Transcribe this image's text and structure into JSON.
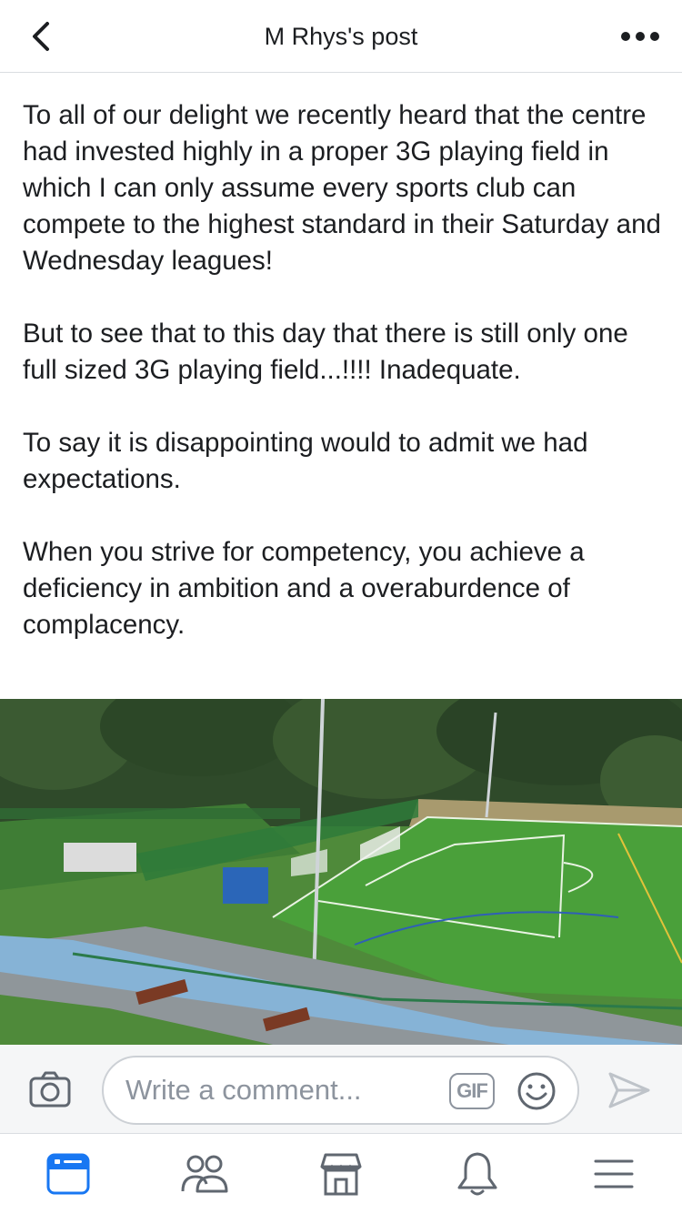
{
  "header": {
    "title": "M Rhys's post",
    "back_icon": "chevron-left-icon",
    "more_icon": "more-horizontal-icon"
  },
  "post": {
    "paragraphs": [
      "To all of our delight we recently heard that the centre had invested highly in a proper 3G playing field in which I can only assume every sports club can compete to the highest standard in their Saturday and Wednesday leagues!",
      "But to see that to this day that there is still only one full sized 3G playing field...!!!! Inadequate.",
      "To say it is disappointing would to admit we had expectations.",
      "When you strive for competency, you achieve a deficiency in ambition and a overaburdence of complacency."
    ]
  },
  "comment_bar": {
    "placeholder": "Write a comment...",
    "gif_label": "GIF",
    "camera_icon": "camera-icon",
    "emoji_icon": "smiley-icon",
    "send_icon": "send-icon"
  },
  "tabbar": {
    "tabs": [
      "news-feed-icon",
      "friends-icon",
      "marketplace-icon",
      "notifications-icon",
      "menu-icon"
    ],
    "active_color": "#1877f2",
    "inactive_color": "#606770"
  }
}
